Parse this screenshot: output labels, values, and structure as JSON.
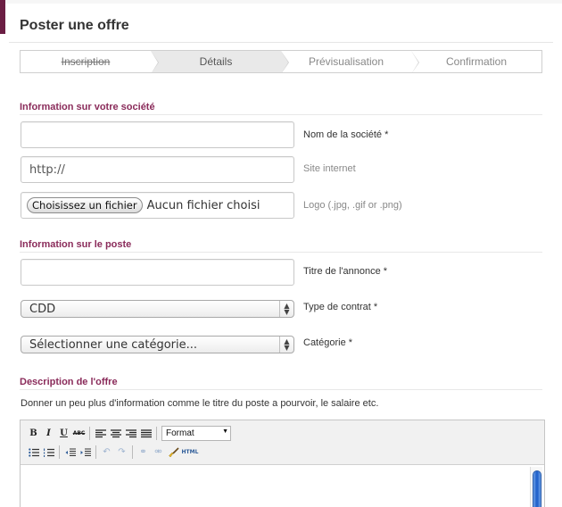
{
  "page": {
    "title": "Poster une offre"
  },
  "steps": [
    {
      "label": "Inscription",
      "state": "done"
    },
    {
      "label": "Détails",
      "state": "active"
    },
    {
      "label": "Prévisualisation",
      "state": "pending"
    },
    {
      "label": "Confirmation",
      "state": "pending"
    }
  ],
  "company": {
    "section_title": "Information sur votre société",
    "name_label": "Nom de la société *",
    "name_value": "",
    "website_label": "Site internet",
    "website_value": "http://",
    "logo_button": "Choisissez un fichier",
    "logo_status": "Aucun fichier choisi",
    "logo_label": "Logo (.jpg, .gif or .png)"
  },
  "job": {
    "section_title": "Information sur le poste",
    "title_label": "Titre de l'annonce *",
    "title_value": "",
    "contract_value": "CDD",
    "contract_label": "Type de contrat *",
    "category_value": "Sélectionner une catégorie...",
    "category_label": "Catégorie *"
  },
  "description": {
    "section_title": "Description de l'offre",
    "help_text": "Donner un peu plus d'information comme le titre du poste a pourvoir, le salaire etc.",
    "format_select": "Format",
    "html_button": "HTML",
    "bold": "B",
    "italic": "I",
    "underline": "U",
    "strike": "ABC"
  },
  "colors": {
    "accent": "#8a2b5a",
    "brand_strip": "#6b1e43"
  }
}
